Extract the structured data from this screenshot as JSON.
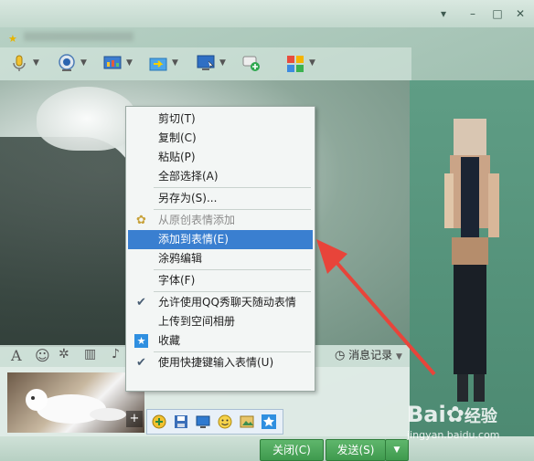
{
  "window": {
    "controls": [
      "▾",
      "–",
      "□",
      "✕"
    ]
  },
  "toolbar": {
    "tools": [
      {
        "icon": "microphone-icon"
      },
      {
        "icon": "webcam-icon"
      },
      {
        "icon": "app-share-icon"
      },
      {
        "icon": "file-transfer-icon"
      },
      {
        "icon": "remote-desktop-icon"
      },
      {
        "icon": "add-contact-icon"
      },
      {
        "icon": "apps-icon"
      }
    ]
  },
  "input_toolbar": {
    "history_label": "消息记录"
  },
  "context_menu": {
    "items": [
      {
        "label": "剪切(T)",
        "state": "normal",
        "icon": ""
      },
      {
        "label": "复制(C)",
        "state": "normal",
        "icon": ""
      },
      {
        "label": "粘贴(P)",
        "state": "normal",
        "icon": ""
      },
      {
        "label": "全部选择(A)",
        "state": "normal",
        "icon": ""
      },
      {
        "sep": true
      },
      {
        "label": "另存为(S)...",
        "state": "normal",
        "icon": ""
      },
      {
        "sep": true
      },
      {
        "label": "从原创表情添加",
        "state": "disabled",
        "icon": "palette-icon"
      },
      {
        "label": "添加到表情(E)",
        "state": "selected",
        "icon": ""
      },
      {
        "label": "涂鸦编辑",
        "state": "normal",
        "icon": ""
      },
      {
        "sep": true
      },
      {
        "label": "字体(F)",
        "state": "normal",
        "icon": ""
      },
      {
        "sep": true
      },
      {
        "label": "允许使用QQ秀聊天随动表情",
        "state": "checked",
        "icon": "check-icon"
      },
      {
        "label": "上传到空间相册",
        "state": "normal",
        "icon": ""
      },
      {
        "label": "收藏",
        "state": "normal",
        "icon": "star-bookmark-icon"
      },
      {
        "sep": true
      },
      {
        "label": "使用快捷键输入表情(U)",
        "state": "checked",
        "icon": "check-icon"
      }
    ]
  },
  "bottom": {
    "close_label": "关闭(C)",
    "send_label": "发送(S)",
    "send_dropdown": "▼"
  },
  "watermark": {
    "brand": "Bai",
    "brand2": "经验",
    "url": "jingyan.baidu.com"
  },
  "colors": {
    "menu_selected": "#3a7fd0",
    "send_green": "#4aa95a",
    "arrow_red": "#e8443a"
  }
}
